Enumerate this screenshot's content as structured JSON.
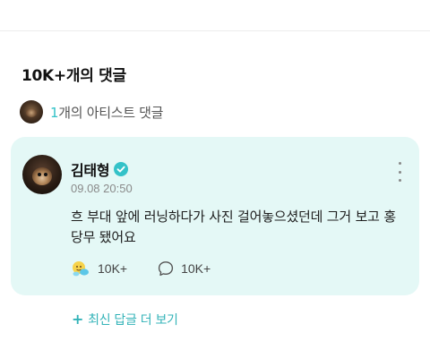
{
  "comments_header": {
    "title": "10K+개의 댓글"
  },
  "artist_comments": {
    "count": "1",
    "label": "개의 아티스트 댓글"
  },
  "comment": {
    "author": "김태형",
    "timestamp": "09.08 20:50",
    "body": "흐 부대 앞에 러닝하다가 사진 걸어놓으셨던데 그거 보고 홍당무 됐어요",
    "like_count": "10K+",
    "reply_count": "10K+",
    "icons": {
      "verified": "verified-badge-icon",
      "more": "more-vertical-icon",
      "like": "reaction-emoji-icon",
      "reply": "speech-bubble-icon"
    }
  },
  "more_replies": {
    "label": "최신 답글 더 보기"
  },
  "colors": {
    "accent": "#33c2c8",
    "card_bg": "#e4f8f6"
  }
}
